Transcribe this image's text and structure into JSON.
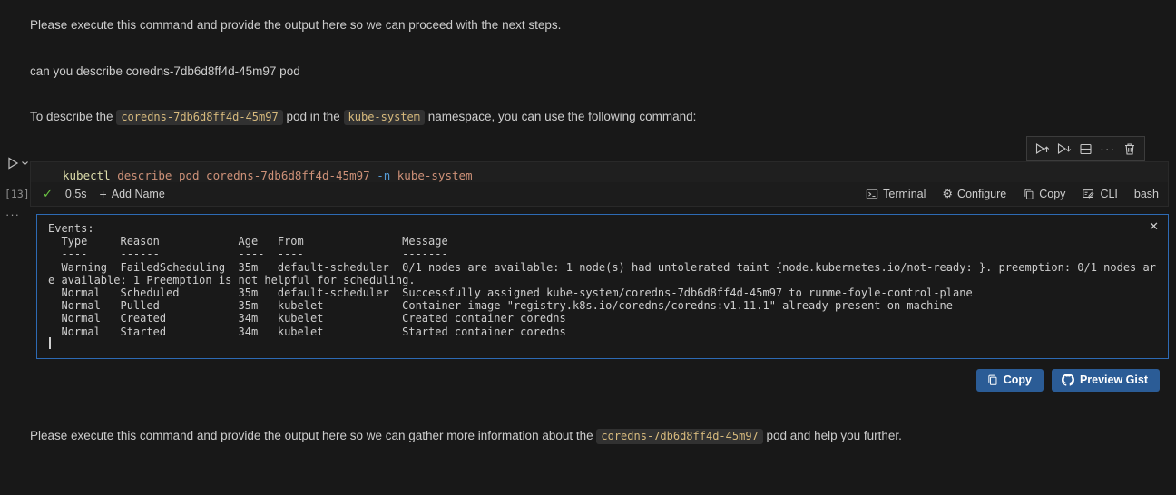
{
  "colors": {
    "page_bg": "#181818",
    "cell_bg": "#1f1f1f",
    "inline_code_fg": "#d7ba7d",
    "token_command": "#dcdcaa",
    "token_argument": "#ce9178",
    "token_flag": "#569cd6",
    "output_border": "#2d6ab4",
    "button_bg": "#2b5c96",
    "success_check": "#6cc644"
  },
  "messages": {
    "para1": "Please execute this command and provide the output here so we can proceed with the next steps.",
    "para2": "can you describe coredns-7db6d8ff4d-45m97 pod",
    "para3_prefix": "To describe the ",
    "para3_code1": "coredns-7db6d8ff4d-45m97",
    "para3_mid": " pod in the ",
    "para3_code2": "kube-system",
    "para3_suffix": " namespace, you can use the following command:",
    "para4_prefix": "Please execute this command and provide the output here so we can gather more information about the ",
    "para4_code": "coredns-7db6d8ff4d-45m97",
    "para4_suffix": " pod and help you further."
  },
  "toolbar": {
    "more_actions_glyph": "···",
    "icons": [
      "execute-above-icon",
      "execute-below-icon",
      "split-cell-icon",
      "more-actions-icon",
      "delete-cell-icon"
    ]
  },
  "cell": {
    "execution_count": "[13]",
    "gutter_more_glyph": "···",
    "code": {
      "command": "kubectl",
      "arguments": " describe pod coredns-7db6d8ff4d-45m97 ",
      "flag": "-n",
      "flag_value": " kube-system"
    },
    "status": {
      "check_glyph": "✓",
      "duration": "0.5s",
      "plus_glyph": "+",
      "add_name": "Add Name",
      "terminal": "Terminal",
      "configure": "Configure",
      "copy": "Copy",
      "cli": "CLI",
      "language": "bash",
      "gear_glyph": "⚙"
    }
  },
  "output": {
    "close_glyph": "✕",
    "lines": [
      "Events:",
      "  Type     Reason            Age   From               Message",
      "  ----     ------            ----  ----               -------",
      "  Warning  FailedScheduling  35m   default-scheduler  0/1 nodes are available: 1 node(s) had untolerated taint {node.kubernetes.io/not-ready: }. preemption: 0/1 nodes ar",
      "e available: 1 Preemption is not helpful for scheduling.",
      "  Normal   Scheduled         35m   default-scheduler  Successfully assigned kube-system/coredns-7db6d8ff4d-45m97 to runme-foyle-control-plane",
      "  Normal   Pulled            35m   kubelet            Container image \"registry.k8s.io/coredns/coredns:v1.11.1\" already present on machine",
      "  Normal   Created           34m   kubelet            Created container coredns",
      "  Normal   Started           34m   kubelet            Started container coredns"
    ]
  },
  "actions": {
    "copy": "Copy",
    "preview_gist": "Preview Gist"
  }
}
